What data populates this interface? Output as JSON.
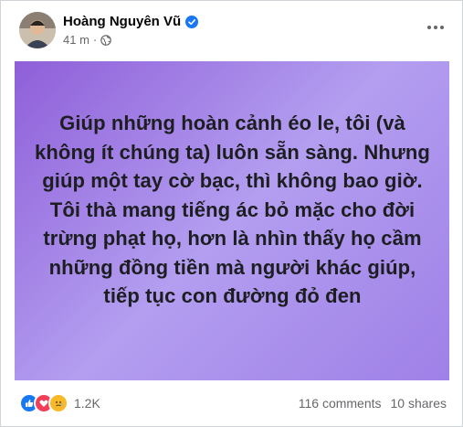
{
  "post": {
    "author": "Hoàng Nguyên Vũ",
    "time": "41 m",
    "dot": "·",
    "text": "Giúp những hoàn cảnh éo le, tôi (và không ít chúng ta) luôn sẵn sàng. Nhưng giúp một tay cờ bạc, thì không bao giờ. Tôi thà mang tiếng ác bỏ mặc cho đời trừng phạt họ, hơn là nhìn thấy họ cầm những đồng tiền mà người khác giúp, tiếp tục con đường đỏ đen",
    "background_color": "#a98be8"
  },
  "footer": {
    "reaction_count": "1.2K",
    "comments": "116 comments",
    "shares": "10 shares"
  },
  "icons": {
    "verified": "verified-badge-icon",
    "privacy": "globe-icon",
    "more": "more-options-icon",
    "reactions": [
      "like-icon",
      "love-icon",
      "sad-icon"
    ]
  },
  "colors": {
    "accent": "#1877f2",
    "secondary_text": "#65676b"
  }
}
